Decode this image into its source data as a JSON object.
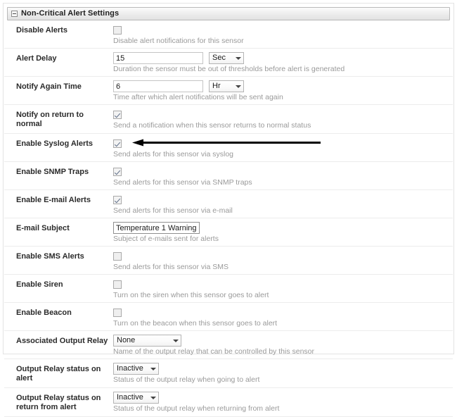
{
  "panel": {
    "title": "Non-Critical Alert Settings",
    "collapse_icon": "minus-box-icon"
  },
  "rows": [
    {
      "label": "Disable Alerts",
      "control": "checkbox",
      "checked": false,
      "hint": "Disable alert notifications for this sensor"
    },
    {
      "label": "Alert Delay",
      "control": "text-with-unit",
      "value": "15",
      "unit": "Sec",
      "hint": "Duration the sensor must be out of thresholds before alert is generated"
    },
    {
      "label": "Notify Again Time",
      "control": "text-with-unit",
      "value": "6",
      "unit": "Hr",
      "hint": "Time after which alert notifications will be sent again"
    },
    {
      "label": "Notify on return to normal",
      "control": "checkbox",
      "checked": true,
      "hint": "Send a notification when this sensor returns to normal status"
    },
    {
      "label": "Enable Syslog Alerts",
      "control": "checkbox",
      "checked": true,
      "hint": "Send alerts for this sensor via syslog"
    },
    {
      "label": "Enable SNMP Traps",
      "control": "checkbox",
      "checked": true,
      "hint": "Send alerts for this sensor via SNMP traps"
    },
    {
      "label": "Enable E-mail Alerts",
      "control": "checkbox",
      "checked": true,
      "hint": "Send alerts for this sensor via e-mail"
    },
    {
      "label": "E-mail Subject",
      "control": "text",
      "value": "Temperature 1 Warning",
      "hint": "Subject of e-mails sent for alerts"
    },
    {
      "label": "Enable SMS Alerts",
      "control": "checkbox",
      "checked": false,
      "hint": "Send alerts for this sensor via SMS"
    },
    {
      "label": "Enable Siren",
      "control": "checkbox",
      "checked": false,
      "hint": "Turn on the siren when this sensor goes to alert"
    },
    {
      "label": "Enable Beacon",
      "control": "checkbox",
      "checked": false,
      "hint": "Turn on the beacon when this sensor goes to alert"
    },
    {
      "label": "Associated Output Relay",
      "control": "select",
      "value": "None",
      "hint": "Name of the output relay that can be controlled by this sensor"
    },
    {
      "label": "Output Relay status on alert",
      "control": "select",
      "value": "Inactive",
      "hint": "Status of the output relay when going to alert"
    },
    {
      "label": "Output Relay status on return from alert",
      "control": "select",
      "value": "Inactive",
      "hint": "Status of the output relay when returning from alert"
    }
  ],
  "annotation": {
    "type": "arrow",
    "direction": "left",
    "points_to": "Enable SNMP Traps checkbox",
    "color": "#000000"
  }
}
